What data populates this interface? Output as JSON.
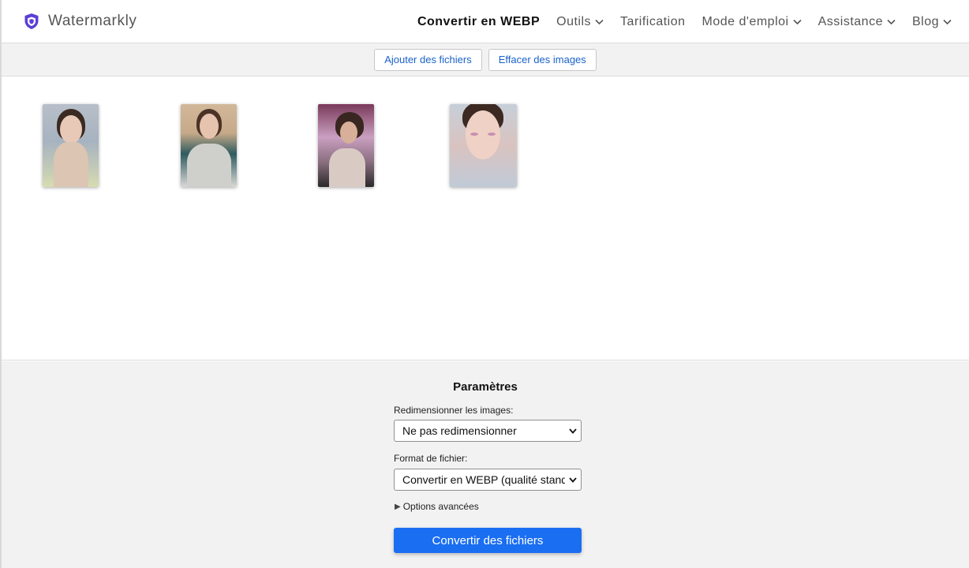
{
  "brand": {
    "name": "Watermarkly",
    "logo_icon": "shield-icon",
    "logo_color": "#5b3fd6"
  },
  "nav": {
    "items": [
      {
        "label": "Convertir en WEBP",
        "dropdown": false,
        "active": true
      },
      {
        "label": "Outils",
        "dropdown": true,
        "active": false
      },
      {
        "label": "Tarification",
        "dropdown": false,
        "active": false
      },
      {
        "label": "Mode d'emploi",
        "dropdown": true,
        "active": false
      },
      {
        "label": "Assistance",
        "dropdown": true,
        "active": false
      },
      {
        "label": "Blog",
        "dropdown": true,
        "active": false
      }
    ]
  },
  "toolbar": {
    "add_files_label": "Ajouter des fichiers",
    "clear_images_label": "Effacer des images"
  },
  "gallery": {
    "images": [
      {
        "alt": "portrait-1"
      },
      {
        "alt": "portrait-2"
      },
      {
        "alt": "portrait-3"
      },
      {
        "alt": "portrait-4"
      }
    ]
  },
  "settings": {
    "title": "Paramètres",
    "resize_label": "Redimensionner les images:",
    "resize_value": "Ne pas redimensionner",
    "format_label": "Format de fichier:",
    "format_value": "Convertir en WEBP (qualité standard)",
    "advanced_label": "Options avancées",
    "convert_label": "Convertir des fichiers"
  },
  "colors": {
    "accent": "#1a6ef2",
    "link": "#1a62c9"
  }
}
